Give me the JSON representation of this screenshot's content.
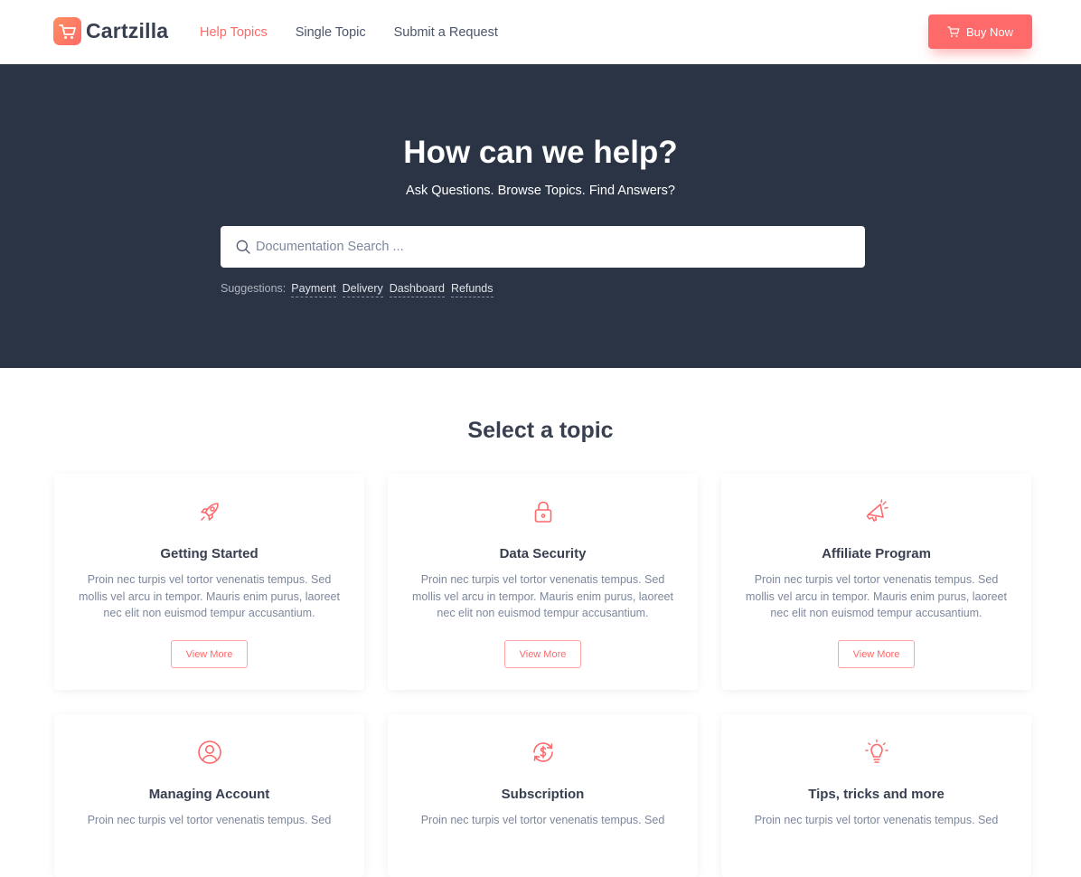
{
  "brand": {
    "name": "Cartzilla",
    "accent": "#fe696a",
    "dark": "#2b3445"
  },
  "nav": {
    "items": [
      {
        "label": "Help Topics",
        "active": true
      },
      {
        "label": "Single Topic",
        "active": false
      },
      {
        "label": "Submit a Request",
        "active": false
      }
    ],
    "buy_label": "Buy Now"
  },
  "hero": {
    "title": "How can we help?",
    "subtitle": "Ask Questions. Browse Topics. Find Answers?",
    "search_placeholder": "Documentation Search ...",
    "suggestions_label": "Suggestions:",
    "suggestions": [
      "Payment",
      "Delivery",
      "Dashboard",
      "Refunds"
    ]
  },
  "topics": {
    "title": "Select a topic",
    "button_label": "View More",
    "cards": [
      {
        "title": "Getting Started",
        "icon": "rocket-icon",
        "text": "Proin nec turpis vel tortor venenatis tempus. Sed mollis vel arcu in tempor. Mauris enim purus, laoreet nec elit non euismod tempur accusantium."
      },
      {
        "title": "Data Security",
        "icon": "lock-icon",
        "text": "Proin nec turpis vel tortor venenatis tempus. Sed mollis vel arcu in tempor. Mauris enim purus, laoreet nec elit non euismod tempur accusantium."
      },
      {
        "title": "Affiliate Program",
        "icon": "megaphone-icon",
        "text": "Proin nec turpis vel tortor venenatis tempus. Sed mollis vel arcu in tempor. Mauris enim purus, laoreet nec elit non euismod tempur accusantium."
      },
      {
        "title": "Managing Account",
        "icon": "user-circle-icon",
        "text": "Proin nec turpis vel tortor venenatis tempus. Sed"
      },
      {
        "title": "Subscription",
        "icon": "dollar-refresh-icon",
        "text": "Proin nec turpis vel tortor venenatis tempus. Sed"
      },
      {
        "title": "Tips, tricks and more",
        "icon": "lightbulb-icon",
        "text": "Proin nec turpis vel tortor venenatis tempus. Sed"
      }
    ]
  }
}
